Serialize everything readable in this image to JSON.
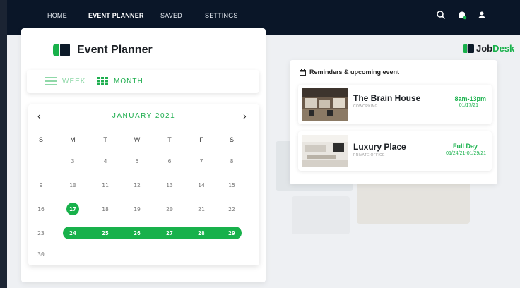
{
  "nav": {
    "items": [
      {
        "label": "HOME",
        "active": false
      },
      {
        "label": "EVENT PLANNER",
        "active": true
      },
      {
        "label": "SAVED",
        "active": false
      },
      {
        "label": "SETTINGS",
        "active": false
      }
    ],
    "icons": [
      "search-icon",
      "notification-icon",
      "user-icon"
    ]
  },
  "planner": {
    "title": "Event Planner",
    "view_week": "WEEK",
    "view_month": "MONTH",
    "active_view": "MONTH"
  },
  "calendar": {
    "month_label": "JANUARY 2021",
    "prev": "‹",
    "next": "›",
    "weekdays": [
      "S",
      "M",
      "T",
      "W",
      "T",
      "F",
      "S"
    ],
    "weeks": [
      [
        "",
        "3",
        "4",
        "5",
        "6",
        "7",
        "8"
      ],
      [
        "9",
        "10",
        "11",
        "12",
        "13",
        "14",
        "15"
      ],
      [
        "16",
        "17",
        "18",
        "19",
        "20",
        "21",
        "22"
      ],
      [
        "23",
        "24",
        "25",
        "26",
        "27",
        "28",
        "29"
      ],
      [
        "30",
        "",
        "",
        "",
        "",
        "",
        ""
      ]
    ],
    "today": "17",
    "range_start": "24",
    "range_end": "29"
  },
  "brand": {
    "part1": "Job",
    "part2": "Desk"
  },
  "reminders": {
    "title": "Reminders & upcoming event",
    "events": [
      {
        "name": "The Brain House",
        "type": "COWORKING",
        "time": "8am-13pm",
        "date": "01/17/21"
      },
      {
        "name": "Luxury Place",
        "type": "PRIVATE OFFICE",
        "time": "Full Day",
        "date": "01/24/21-01/29/21"
      }
    ]
  },
  "colors": {
    "accent": "#18b14b",
    "nav_bg": "#0a1628",
    "page_bg": "#eef0f3"
  }
}
